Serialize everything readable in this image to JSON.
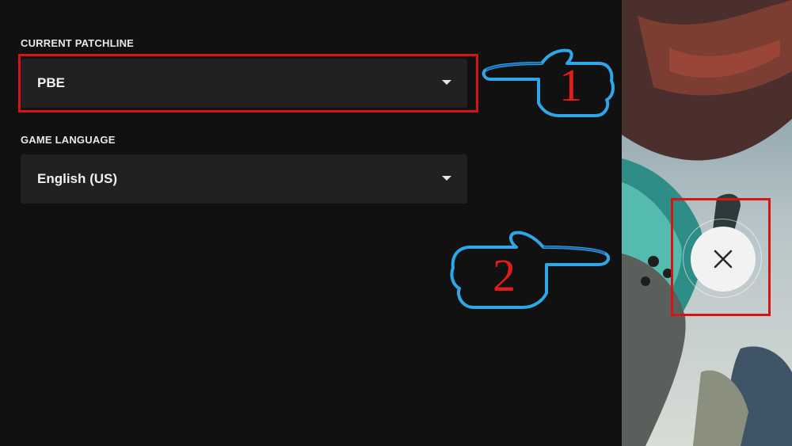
{
  "settings": {
    "patchline": {
      "label": "CURRENT PATCHLINE",
      "value": "PBE"
    },
    "language": {
      "label": "GAME LANGUAGE",
      "value": "English (US)"
    }
  },
  "annotations": {
    "step1": "1",
    "step2": "2",
    "highlight_color": "#d71414",
    "pointer_color": "#2ea6e8"
  },
  "icons": {
    "caret": "caret-down-icon",
    "close": "close-icon",
    "pointer": "pointing-hand-icon"
  }
}
